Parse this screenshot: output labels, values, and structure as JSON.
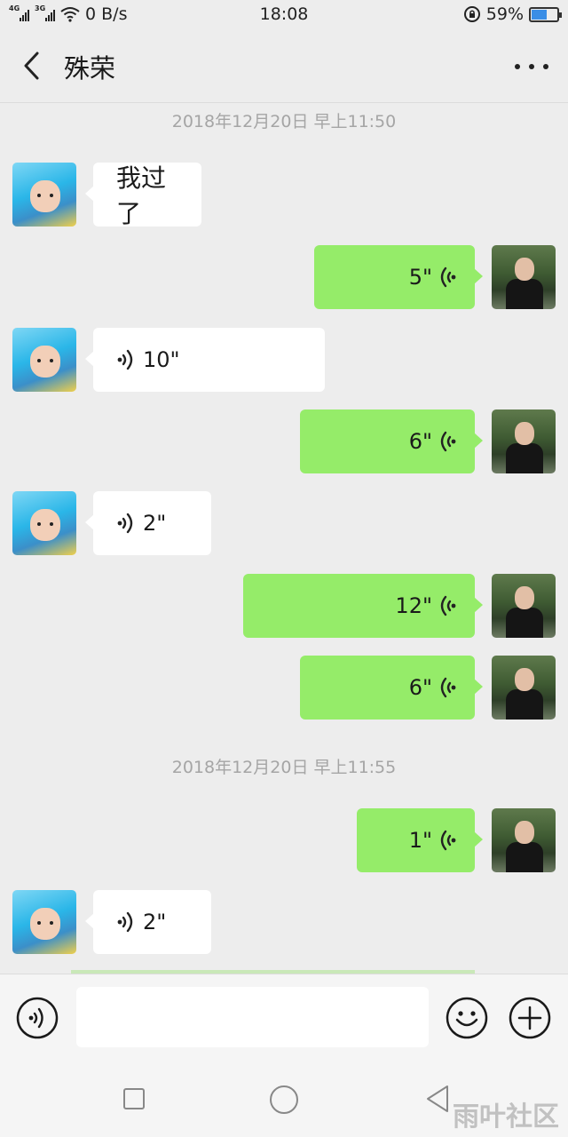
{
  "status_bar": {
    "net1": "4G",
    "net2": "3G",
    "speed": "0 B/s",
    "time": "18:08",
    "battery": "59%",
    "battery_level": 0.59
  },
  "header": {
    "back_icon": "chevron-left-icon",
    "title": "殊荣",
    "more_icon": "more-dots-icon"
  },
  "chat": {
    "timestamps": [
      "2018年12月20日 早上11:50",
      "2018年12月20日 早上11:55"
    ],
    "messages": [
      {
        "from": "other",
        "type": "text",
        "content": "我过了"
      },
      {
        "from": "me",
        "type": "voice",
        "duration": "5\""
      },
      {
        "from": "other",
        "type": "voice",
        "duration": "10\""
      },
      {
        "from": "me",
        "type": "voice",
        "duration": "6\""
      },
      {
        "from": "other",
        "type": "voice",
        "duration": "2\""
      },
      {
        "from": "me",
        "type": "voice",
        "duration": "12\""
      },
      {
        "from": "me",
        "type": "voice",
        "duration": "6\""
      },
      {
        "from": "me",
        "type": "voice",
        "duration": "1\""
      },
      {
        "from": "other",
        "type": "voice",
        "duration": "2\""
      }
    ]
  },
  "input_bar": {
    "voice_icon": "voice-mode-icon",
    "text_value": "",
    "emoji_icon": "emoji-icon",
    "plus_icon": "plus-icon"
  },
  "nav_bar": {
    "watermark": "雨叶社区"
  },
  "colors": {
    "sent_bubble": "#95ec69",
    "received_bubble": "#ffffff",
    "background": "#ededed"
  }
}
